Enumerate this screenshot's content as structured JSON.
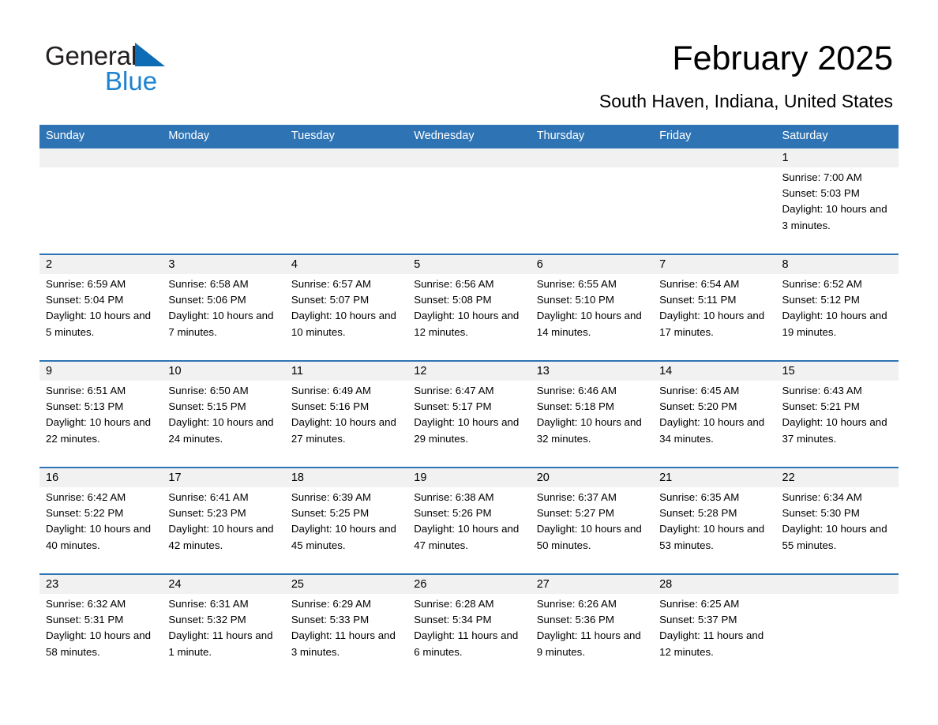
{
  "brand": {
    "name_part1": "General",
    "name_part2": "Blue",
    "accent_color": "#1c82d2",
    "triangle_color": "#0d6cb4"
  },
  "header": {
    "title": "February 2025",
    "subtitle": "South Haven, Indiana, United States"
  },
  "theme": {
    "header_bar_color": "#2e74b5",
    "day_number_band_color": "#f1f1f1",
    "text_color": "#000000"
  },
  "weekdays": [
    "Sunday",
    "Monday",
    "Tuesday",
    "Wednesday",
    "Thursday",
    "Friday",
    "Saturday"
  ],
  "weeks": [
    [
      {
        "day": "",
        "sunrise": "",
        "sunset": "",
        "daylight": "",
        "empty": true
      },
      {
        "day": "",
        "sunrise": "",
        "sunset": "",
        "daylight": "",
        "empty": true
      },
      {
        "day": "",
        "sunrise": "",
        "sunset": "",
        "daylight": "",
        "empty": true
      },
      {
        "day": "",
        "sunrise": "",
        "sunset": "",
        "daylight": "",
        "empty": true
      },
      {
        "day": "",
        "sunrise": "",
        "sunset": "",
        "daylight": "",
        "empty": true
      },
      {
        "day": "",
        "sunrise": "",
        "sunset": "",
        "daylight": "",
        "empty": true
      },
      {
        "day": "1",
        "sunrise": "Sunrise: 7:00 AM",
        "sunset": "Sunset: 5:03 PM",
        "daylight": "Daylight: 10 hours and 3 minutes."
      }
    ],
    [
      {
        "day": "2",
        "sunrise": "Sunrise: 6:59 AM",
        "sunset": "Sunset: 5:04 PM",
        "daylight": "Daylight: 10 hours and 5 minutes."
      },
      {
        "day": "3",
        "sunrise": "Sunrise: 6:58 AM",
        "sunset": "Sunset: 5:06 PM",
        "daylight": "Daylight: 10 hours and 7 minutes."
      },
      {
        "day": "4",
        "sunrise": "Sunrise: 6:57 AM",
        "sunset": "Sunset: 5:07 PM",
        "daylight": "Daylight: 10 hours and 10 minutes."
      },
      {
        "day": "5",
        "sunrise": "Sunrise: 6:56 AM",
        "sunset": "Sunset: 5:08 PM",
        "daylight": "Daylight: 10 hours and 12 minutes."
      },
      {
        "day": "6",
        "sunrise": "Sunrise: 6:55 AM",
        "sunset": "Sunset: 5:10 PM",
        "daylight": "Daylight: 10 hours and 14 minutes."
      },
      {
        "day": "7",
        "sunrise": "Sunrise: 6:54 AM",
        "sunset": "Sunset: 5:11 PM",
        "daylight": "Daylight: 10 hours and 17 minutes."
      },
      {
        "day": "8",
        "sunrise": "Sunrise: 6:52 AM",
        "sunset": "Sunset: 5:12 PM",
        "daylight": "Daylight: 10 hours and 19 minutes."
      }
    ],
    [
      {
        "day": "9",
        "sunrise": "Sunrise: 6:51 AM",
        "sunset": "Sunset: 5:13 PM",
        "daylight": "Daylight: 10 hours and 22 minutes."
      },
      {
        "day": "10",
        "sunrise": "Sunrise: 6:50 AM",
        "sunset": "Sunset: 5:15 PM",
        "daylight": "Daylight: 10 hours and 24 minutes."
      },
      {
        "day": "11",
        "sunrise": "Sunrise: 6:49 AM",
        "sunset": "Sunset: 5:16 PM",
        "daylight": "Daylight: 10 hours and 27 minutes."
      },
      {
        "day": "12",
        "sunrise": "Sunrise: 6:47 AM",
        "sunset": "Sunset: 5:17 PM",
        "daylight": "Daylight: 10 hours and 29 minutes."
      },
      {
        "day": "13",
        "sunrise": "Sunrise: 6:46 AM",
        "sunset": "Sunset: 5:18 PM",
        "daylight": "Daylight: 10 hours and 32 minutes."
      },
      {
        "day": "14",
        "sunrise": "Sunrise: 6:45 AM",
        "sunset": "Sunset: 5:20 PM",
        "daylight": "Daylight: 10 hours and 34 minutes."
      },
      {
        "day": "15",
        "sunrise": "Sunrise: 6:43 AM",
        "sunset": "Sunset: 5:21 PM",
        "daylight": "Daylight: 10 hours and 37 minutes."
      }
    ],
    [
      {
        "day": "16",
        "sunrise": "Sunrise: 6:42 AM",
        "sunset": "Sunset: 5:22 PM",
        "daylight": "Daylight: 10 hours and 40 minutes."
      },
      {
        "day": "17",
        "sunrise": "Sunrise: 6:41 AM",
        "sunset": "Sunset: 5:23 PM",
        "daylight": "Daylight: 10 hours and 42 minutes."
      },
      {
        "day": "18",
        "sunrise": "Sunrise: 6:39 AM",
        "sunset": "Sunset: 5:25 PM",
        "daylight": "Daylight: 10 hours and 45 minutes."
      },
      {
        "day": "19",
        "sunrise": "Sunrise: 6:38 AM",
        "sunset": "Sunset: 5:26 PM",
        "daylight": "Daylight: 10 hours and 47 minutes."
      },
      {
        "day": "20",
        "sunrise": "Sunrise: 6:37 AM",
        "sunset": "Sunset: 5:27 PM",
        "daylight": "Daylight: 10 hours and 50 minutes."
      },
      {
        "day": "21",
        "sunrise": "Sunrise: 6:35 AM",
        "sunset": "Sunset: 5:28 PM",
        "daylight": "Daylight: 10 hours and 53 minutes."
      },
      {
        "day": "22",
        "sunrise": "Sunrise: 6:34 AM",
        "sunset": "Sunset: 5:30 PM",
        "daylight": "Daylight: 10 hours and 55 minutes."
      }
    ],
    [
      {
        "day": "23",
        "sunrise": "Sunrise: 6:32 AM",
        "sunset": "Sunset: 5:31 PM",
        "daylight": "Daylight: 10 hours and 58 minutes."
      },
      {
        "day": "24",
        "sunrise": "Sunrise: 6:31 AM",
        "sunset": "Sunset: 5:32 PM",
        "daylight": "Daylight: 11 hours and 1 minute."
      },
      {
        "day": "25",
        "sunrise": "Sunrise: 6:29 AM",
        "sunset": "Sunset: 5:33 PM",
        "daylight": "Daylight: 11 hours and 3 minutes."
      },
      {
        "day": "26",
        "sunrise": "Sunrise: 6:28 AM",
        "sunset": "Sunset: 5:34 PM",
        "daylight": "Daylight: 11 hours and 6 minutes."
      },
      {
        "day": "27",
        "sunrise": "Sunrise: 6:26 AM",
        "sunset": "Sunset: 5:36 PM",
        "daylight": "Daylight: 11 hours and 9 minutes."
      },
      {
        "day": "28",
        "sunrise": "Sunrise: 6:25 AM",
        "sunset": "Sunset: 5:37 PM",
        "daylight": "Daylight: 11 hours and 12 minutes."
      },
      {
        "day": "",
        "sunrise": "",
        "sunset": "",
        "daylight": "",
        "empty": true
      }
    ]
  ]
}
